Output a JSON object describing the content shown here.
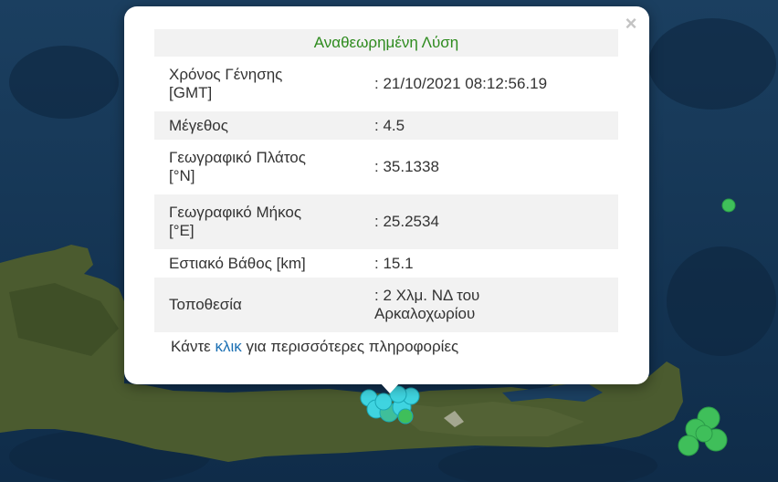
{
  "popup": {
    "close_symbol": "×",
    "title": "Αναθεωρημένη Λύση",
    "title_color": "#2e8b1e",
    "rows": [
      {
        "label_line1": "Χρόνος Γένησης",
        "label_line2": "[GMT]",
        "value_line1": ": 21/10/2021 08:12:56.19",
        "value_line2": ""
      },
      {
        "label_line1": "Μέγεθος",
        "label_line2": "",
        "value_line1": ": 4.5",
        "value_line2": ""
      },
      {
        "label_line1": "Γεωγραφικό Πλάτος",
        "label_line2": "[°N]",
        "value_line1": ": 35.1338",
        "value_line2": ""
      },
      {
        "label_line1": "Γεωγραφικό Μήκος",
        "label_line2": "[°E]",
        "value_line1": ": 25.2534",
        "value_line2": ""
      },
      {
        "label_line1": "Εστιακό Βάθος [km]",
        "label_line2": "",
        "value_line1": ": 15.1",
        "value_line2": ""
      },
      {
        "label_line1": "Τοποθεσία",
        "label_line2": "",
        "value_line1": ": 2 Χλμ. ΝΔ του",
        "value_line2": "Αρκαλοχωρίου"
      }
    ],
    "more_prefix": "Κάντε ",
    "more_link": "κλικ",
    "more_suffix": " για περισσότερες πληροφορίες"
  },
  "map": {
    "sea_color": "#15385a",
    "land_color": "#4a5a2e",
    "marker_colors": {
      "aftershock": "#3fbf5a",
      "main_cluster": "#3fd4e0"
    }
  }
}
